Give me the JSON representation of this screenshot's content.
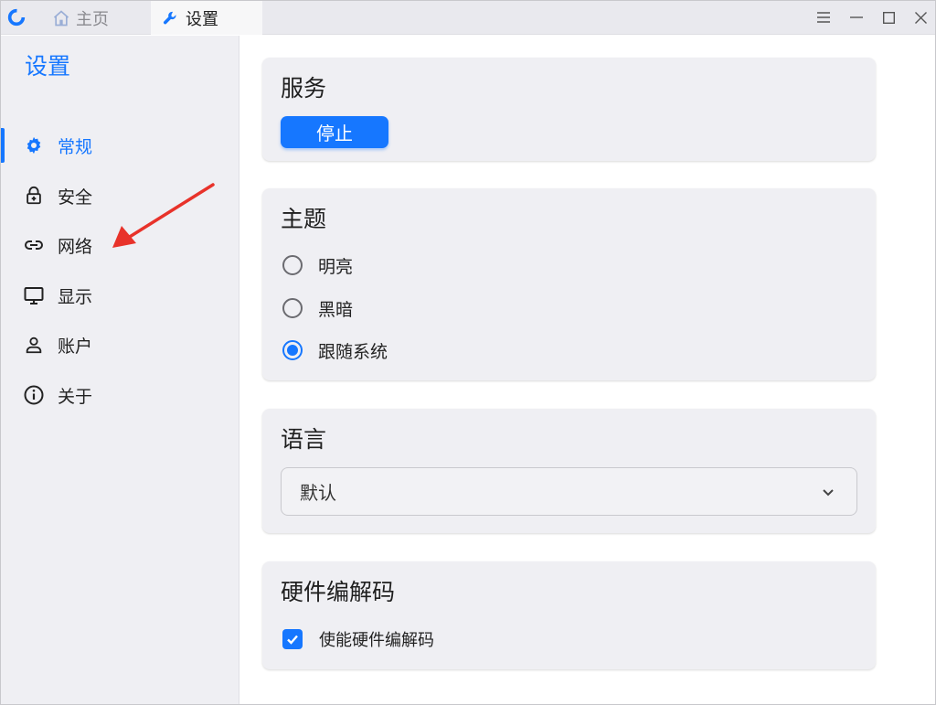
{
  "tabs": {
    "home": "主页",
    "settings": "设置"
  },
  "sidebar": {
    "title": "设置",
    "items": [
      {
        "label": "常规",
        "icon": "gear-icon",
        "active": true
      },
      {
        "label": "安全",
        "icon": "lock-icon",
        "active": false
      },
      {
        "label": "网络",
        "icon": "link-icon",
        "active": false
      },
      {
        "label": "显示",
        "icon": "monitor-icon",
        "active": false
      },
      {
        "label": "账户",
        "icon": "user-icon",
        "active": false
      },
      {
        "label": "关于",
        "icon": "info-icon",
        "active": false
      }
    ]
  },
  "service": {
    "title": "服务",
    "button": "停止"
  },
  "theme": {
    "title": "主题",
    "options": [
      "明亮",
      "黑暗",
      "跟随系统"
    ],
    "selected": "跟随系统"
  },
  "language": {
    "title": "语言",
    "value": "默认"
  },
  "hwcodec": {
    "title": "硬件编解码",
    "checkbox_label": "使能硬件编解码",
    "checked": true
  },
  "colors": {
    "accent": "#1677ff",
    "annotation": "#e8322a"
  }
}
